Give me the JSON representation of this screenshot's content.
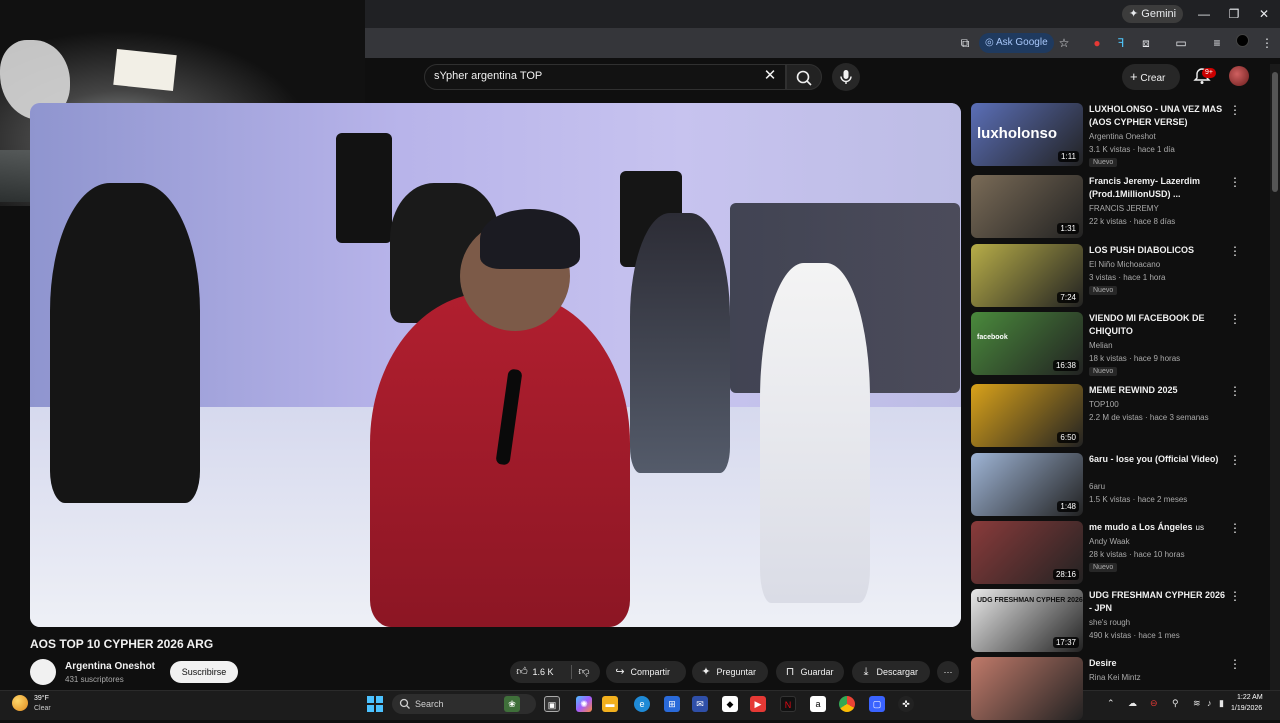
{
  "browser": {
    "gemini_label": "Gemini",
    "ask_google_label": "Ask Google",
    "window_controls": [
      "—",
      "❐",
      "✕"
    ]
  },
  "header": {
    "search_value": "sYpher argentina TOP",
    "create_label": "Crear",
    "notification_count": "9+"
  },
  "video": {
    "title": "AOS TOP 10 CYPHER 2026 ARG",
    "channel_name": "Argentina Oneshot",
    "subscribers": "431 suscriptores",
    "subscribe_label": "Suscribirse",
    "likes": "1.6 K",
    "share_label": "Compartir",
    "ask_label": "Preguntar",
    "save_label": "Guardar",
    "download_label": "Descargar"
  },
  "recommendations": [
    {
      "title": "LUXHOLONSO - UNA VEZ MAS (AOS CYPHER VERSE)",
      "channel": "Argentina Oneshot",
      "meta": "3.1 K vistas · hace 1 día",
      "badge": "Nuevo",
      "duration": "1:11",
      "thumb_text": "luxholonso",
      "thumb_color": "#5b6fb8"
    },
    {
      "title": "Francis Jeremy- Lazerdim (Prod.1MillionUSD) ...",
      "channel": "FRANCIS JEREMY",
      "meta": "22 k vistas · hace 8 días",
      "badge": "",
      "duration": "1:31",
      "thumb_text": "",
      "thumb_color": "#7a6b57"
    },
    {
      "title": "LOS PUSH DIABOLICOS",
      "channel": "El Niño Michoacano",
      "meta": "3 vistas · hace 1 hora",
      "badge": "Nuevo",
      "duration": "7:24",
      "thumb_text": "",
      "thumb_color": "#b7ad48"
    },
    {
      "title": "VIENDO MI FACEBOOK DE CHIQUITO",
      "channel": "Melian",
      "meta": "18 k vistas · hace 9 horas",
      "badge": "Nuevo",
      "duration": "16:38",
      "thumb_text": "facebook",
      "thumb_color": "#4a8a3c"
    },
    {
      "title": "MEME REWIND 2025",
      "channel": "TOP100",
      "meta": "2.2 M de vistas · hace 3 semanas",
      "badge": "",
      "duration": "6:50",
      "thumb_text": "",
      "thumb_color": "#d9a21a"
    },
    {
      "title": "6aru - lose you (Official Video)",
      "channel": "6aru",
      "meta": "1.5 K vistas · hace 2 meses",
      "badge": "",
      "duration": "1:48",
      "thumb_text": "",
      "thumb_color": "#9fb5d6"
    },
    {
      "title": "me mudo a Los Ángeles",
      "title_suffix": "us",
      "channel": "Andy Waak",
      "meta": "28 k vistas · hace 10 horas",
      "badge": "Nuevo",
      "duration": "28:16",
      "thumb_text": "",
      "thumb_color": "#8a3b3b"
    },
    {
      "title": "UDG FRESHMAN CYPHER 2026 - JPN",
      "channel": "she's rough",
      "meta": "490 k vistas · hace 1 mes",
      "badge": "",
      "duration": "17:37",
      "thumb_text": "UDG FRESHMAN CYPHER 2026",
      "thumb_color": "#e9e9e9"
    },
    {
      "title": "Desire",
      "channel": "Rina Kei Mintz",
      "meta": "",
      "badge": "",
      "duration": "",
      "thumb_text": "",
      "thumb_color": "#c07a6a"
    }
  ],
  "taskbar": {
    "weather_temp": "39°F",
    "weather_desc": "Clear",
    "search_label": "Search",
    "time": "1:22 AM",
    "date": "1/19/2026"
  },
  "colors": {
    "background": "#0f0f0f",
    "accent_red": "#cc0000",
    "text": "#f1f1f1",
    "muted": "#aaaaaa"
  }
}
